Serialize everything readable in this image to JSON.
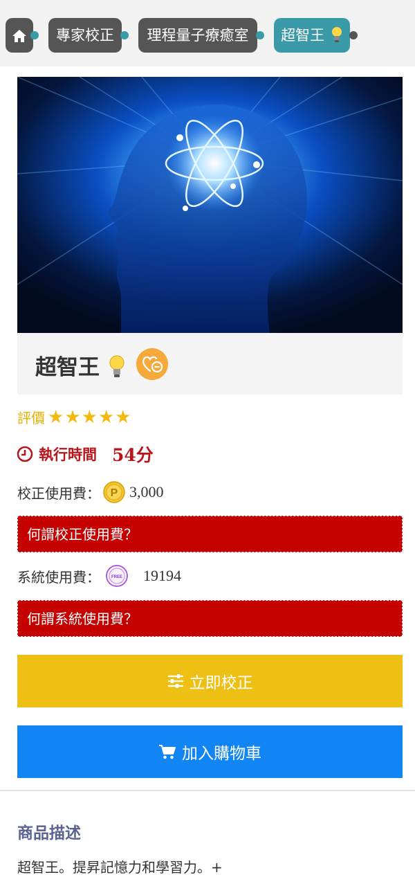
{
  "breadcrumb": {
    "home_icon": "home-icon",
    "items": [
      {
        "label": "專家校正"
      },
      {
        "label": "理程量子療癒室"
      },
      {
        "label": "超智王"
      }
    ]
  },
  "product": {
    "title": "超智王",
    "bulb_icon": "light-bulb-icon",
    "favorite_icon": "heart-minus-icon"
  },
  "rating": {
    "label": "評價",
    "stars": 5,
    "max_stars": 5
  },
  "exec_time": {
    "label": "執行時間",
    "value": "54分",
    "icon": "clock-icon"
  },
  "calibration_fee": {
    "label": "校正使用費：",
    "coin_icon": "p-coin-icon",
    "value": "3,000",
    "help_label": "何謂校正使用費？"
  },
  "system_fee": {
    "label": "系統使用費：",
    "coin_icon": "free-coin-icon",
    "value": "19194",
    "help_label": "何謂系統使用費？"
  },
  "buttons": {
    "calibrate": "立即校正",
    "add_to_cart": "加入購物車"
  },
  "description": {
    "title": "商品描述",
    "text": "超智王。提昇記憶力和學習力。+"
  },
  "colors": {
    "teal": "#3a9aa7",
    "dark_gray": "#555555",
    "red": "#c40000",
    "yellow": "#eec013",
    "blue": "#1285f5",
    "star": "#f2b90f"
  }
}
